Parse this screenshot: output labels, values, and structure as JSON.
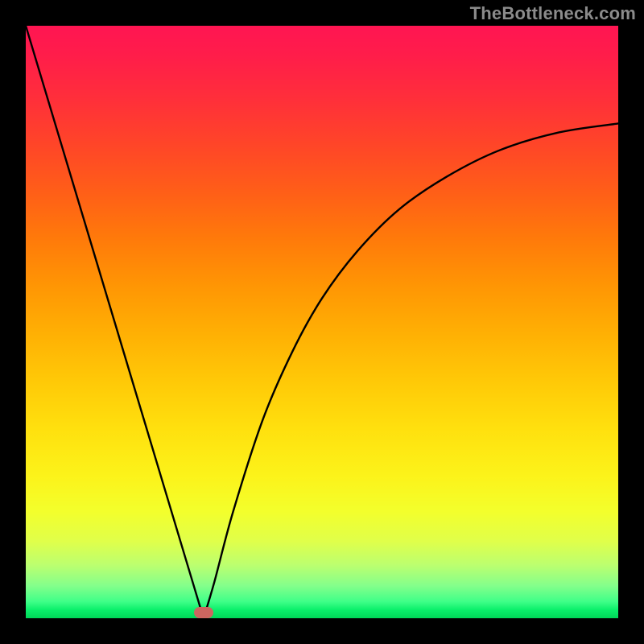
{
  "watermark": "TheBottleneck.com",
  "chart_data": {
    "type": "line",
    "title": "",
    "xlabel": "",
    "ylabel": "",
    "xlim": [
      0,
      1
    ],
    "ylim": [
      0,
      1
    ],
    "grid": false,
    "background_gradient": {
      "direction": "vertical",
      "stops": [
        {
          "pos": 0.0,
          "color": "#ff1552"
        },
        {
          "pos": 0.4,
          "color": "#ff8a06"
        },
        {
          "pos": 0.75,
          "color": "#fff015"
        },
        {
          "pos": 0.92,
          "color": "#b8ff70"
        },
        {
          "pos": 1.0,
          "color": "#00d758"
        }
      ]
    },
    "curve": {
      "description": "V-shaped curve touching x-axis near x≈0.30; left branch nearly linear to top-left corner, right branch concave rising toward x=1 at y≈0.83",
      "vertex": {
        "x": 0.3,
        "y": 0.0
      },
      "points": [
        {
          "x": 0.0,
          "y": 1.0
        },
        {
          "x": 0.06,
          "y": 0.8
        },
        {
          "x": 0.12,
          "y": 0.6
        },
        {
          "x": 0.18,
          "y": 0.4
        },
        {
          "x": 0.24,
          "y": 0.2
        },
        {
          "x": 0.282,
          "y": 0.06
        },
        {
          "x": 0.3,
          "y": 0.0
        },
        {
          "x": 0.318,
          "y": 0.06
        },
        {
          "x": 0.35,
          "y": 0.18
        },
        {
          "x": 0.4,
          "y": 0.335
        },
        {
          "x": 0.45,
          "y": 0.45
        },
        {
          "x": 0.5,
          "y": 0.54
        },
        {
          "x": 0.56,
          "y": 0.62
        },
        {
          "x": 0.63,
          "y": 0.69
        },
        {
          "x": 0.71,
          "y": 0.745
        },
        {
          "x": 0.8,
          "y": 0.79
        },
        {
          "x": 0.9,
          "y": 0.82
        },
        {
          "x": 1.0,
          "y": 0.835
        }
      ]
    },
    "marker": {
      "shape": "capsule",
      "color": "#cc6660",
      "x": 0.3,
      "y": 0.01
    }
  }
}
